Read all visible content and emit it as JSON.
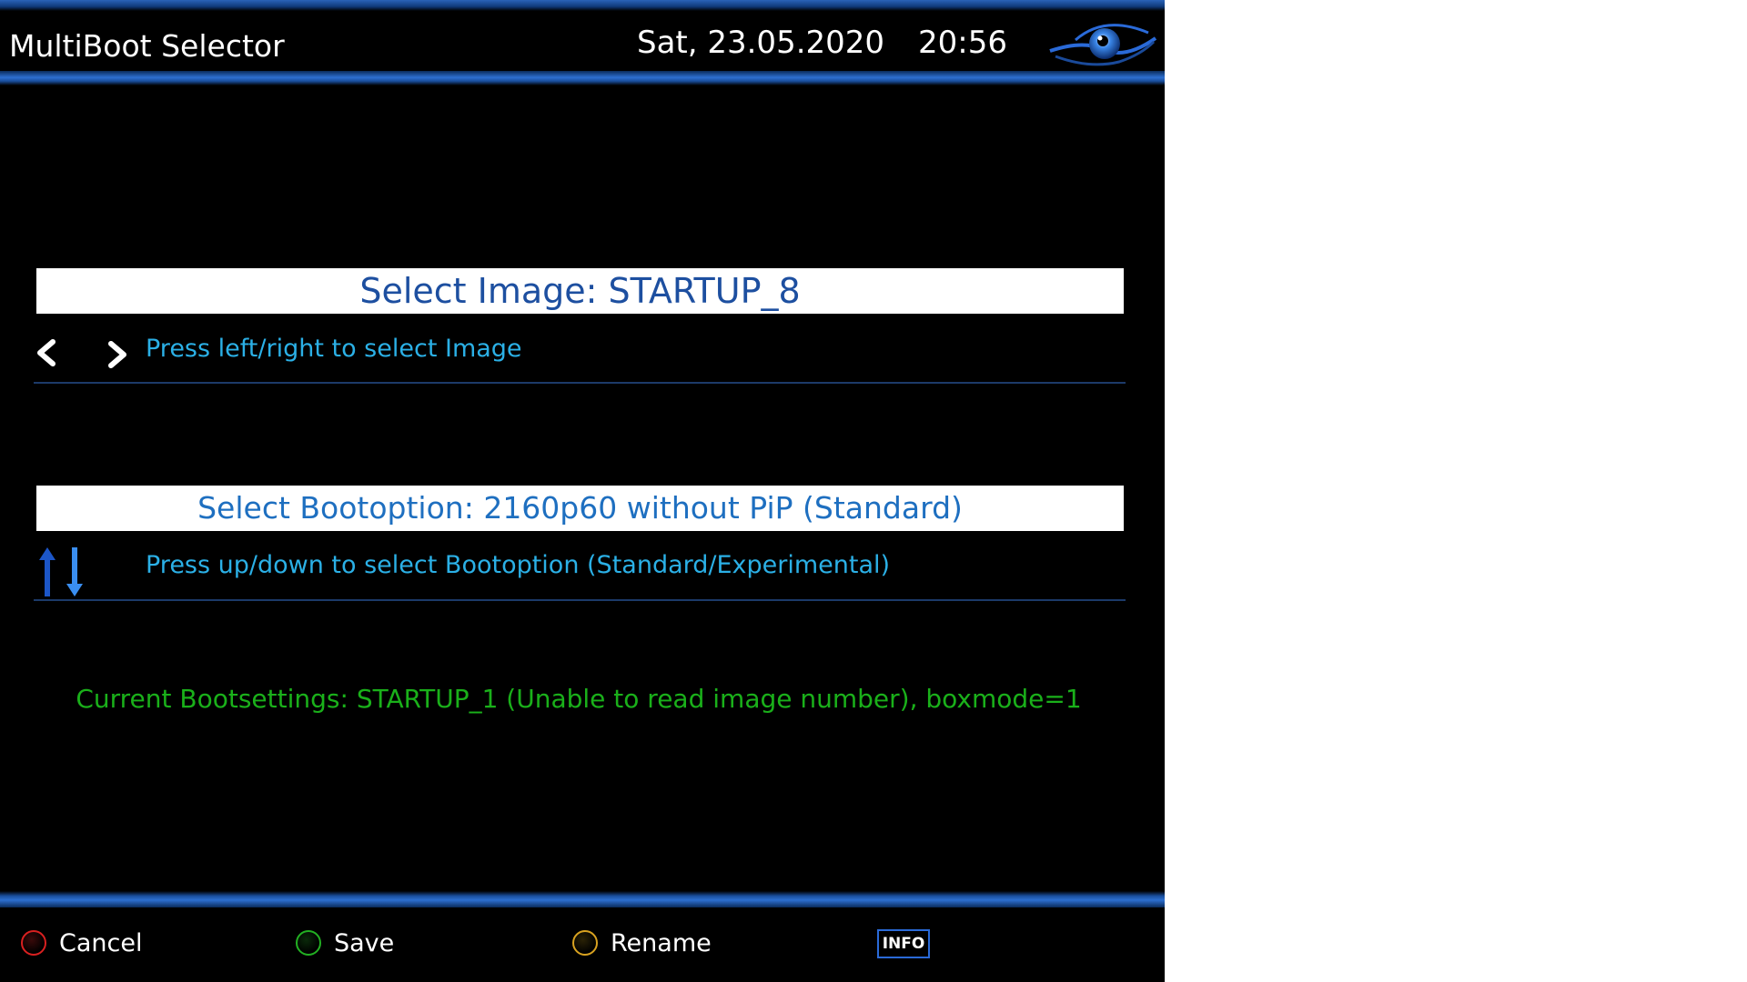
{
  "header": {
    "title": "MultiBoot Selector",
    "date": "Sat, 23.05.2020",
    "time": "20:56",
    "logo_icon": "eye-logo-icon"
  },
  "image_select": {
    "label": "Select Image: STARTUP_8",
    "hint": "Press left/right to select Image"
  },
  "boot_select": {
    "label": "Select Bootoption: 2160p60 without PiP (Standard)",
    "hint": "Press up/down to select Bootoption (Standard/Experimental)"
  },
  "current_settings": "Current Bootsettings: STARTUP_1 (Unable to read image number), boxmode=1",
  "footer": {
    "cancel": "Cancel",
    "save": "Save",
    "rename": "Rename",
    "info": "INFO"
  },
  "colors": {
    "accent": "#2d6fd0",
    "hint_text": "#2bb0e6",
    "status_text": "#1ab01a",
    "red_button": "#d92020",
    "green_button": "#22b022",
    "yellow_button": "#d8a220"
  }
}
